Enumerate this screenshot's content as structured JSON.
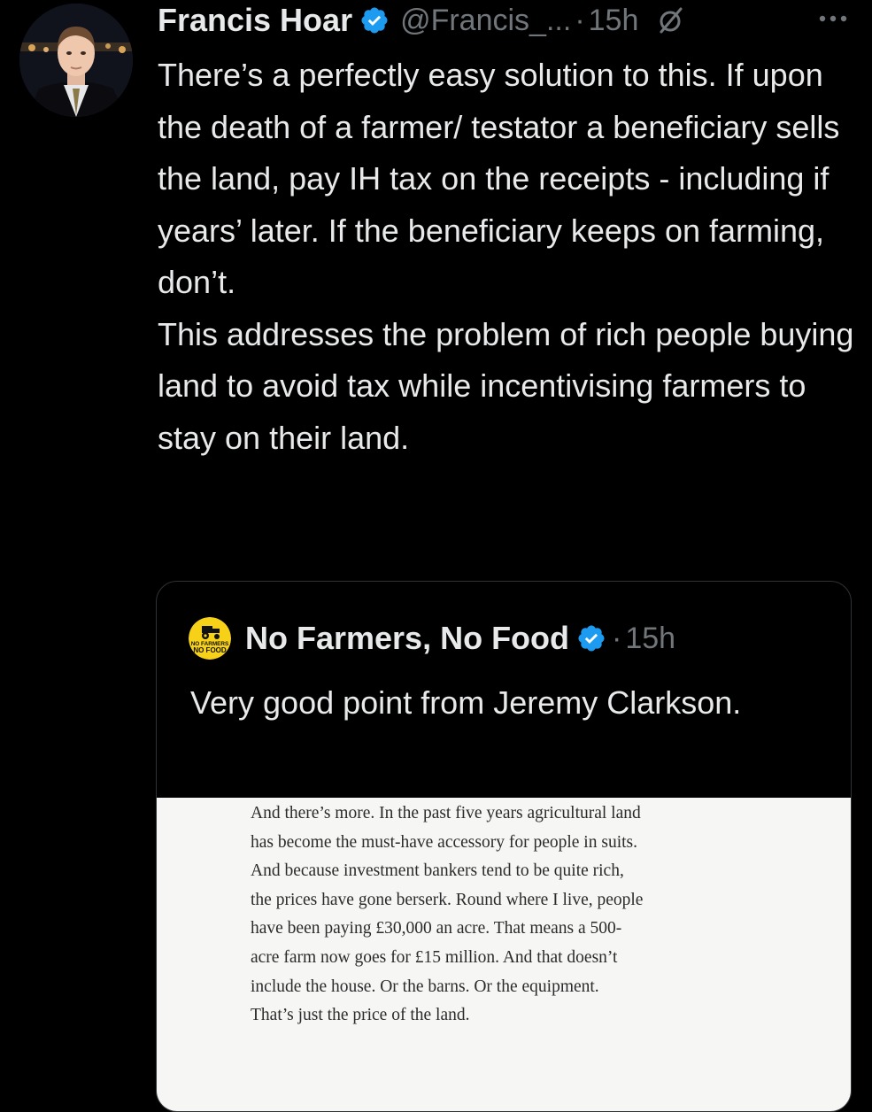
{
  "tweet": {
    "author_name": "Francis Hoar",
    "handle": "@Francis_...",
    "separator": "·",
    "time": "15h",
    "verified_icon": "verified-badge-icon",
    "grok_icon": "grok-icon",
    "more_icon": "more-options-icon",
    "text": "There’s a perfectly easy solution to this. If upon the death of a farmer/ testator a beneficiary sells the land, pay IH tax on the receipts - including if years’ later. If the beneficiary keeps on farming, don’t.\nThis addresses the problem of rich people buying land to avoid tax while incentivising farmers to stay on their land."
  },
  "quote": {
    "author_name": "No Farmers, No Food",
    "separator": "·",
    "time": "15h",
    "logo_text_line1": "NO FARMERS",
    "logo_text_line2": "NO FOOD",
    "text": "Very good point from Jeremy Clarkson.",
    "article_lines": [
      "And there’s more. In the past five years agricultural land",
      "has become the must-have accessory for people in suits.",
      "And because investment bankers tend to be quite rich,",
      "the prices have gone berserk. Round where I live, people",
      "have been paying £30,000 an acre. That means a 500-",
      "acre farm now goes for £15 million. And that doesn’t",
      "include the house. Or the barns. Or the equipment.",
      "That’s just the price of the land."
    ]
  },
  "colors": {
    "background": "#000000",
    "primary_text": "#e7e9ea",
    "secondary_text": "#71767b",
    "verified_blue": "#1d9bf0",
    "card_border": "#2f3336",
    "logo_yellow": "#f7d117",
    "article_bg": "#f6f6f5"
  }
}
